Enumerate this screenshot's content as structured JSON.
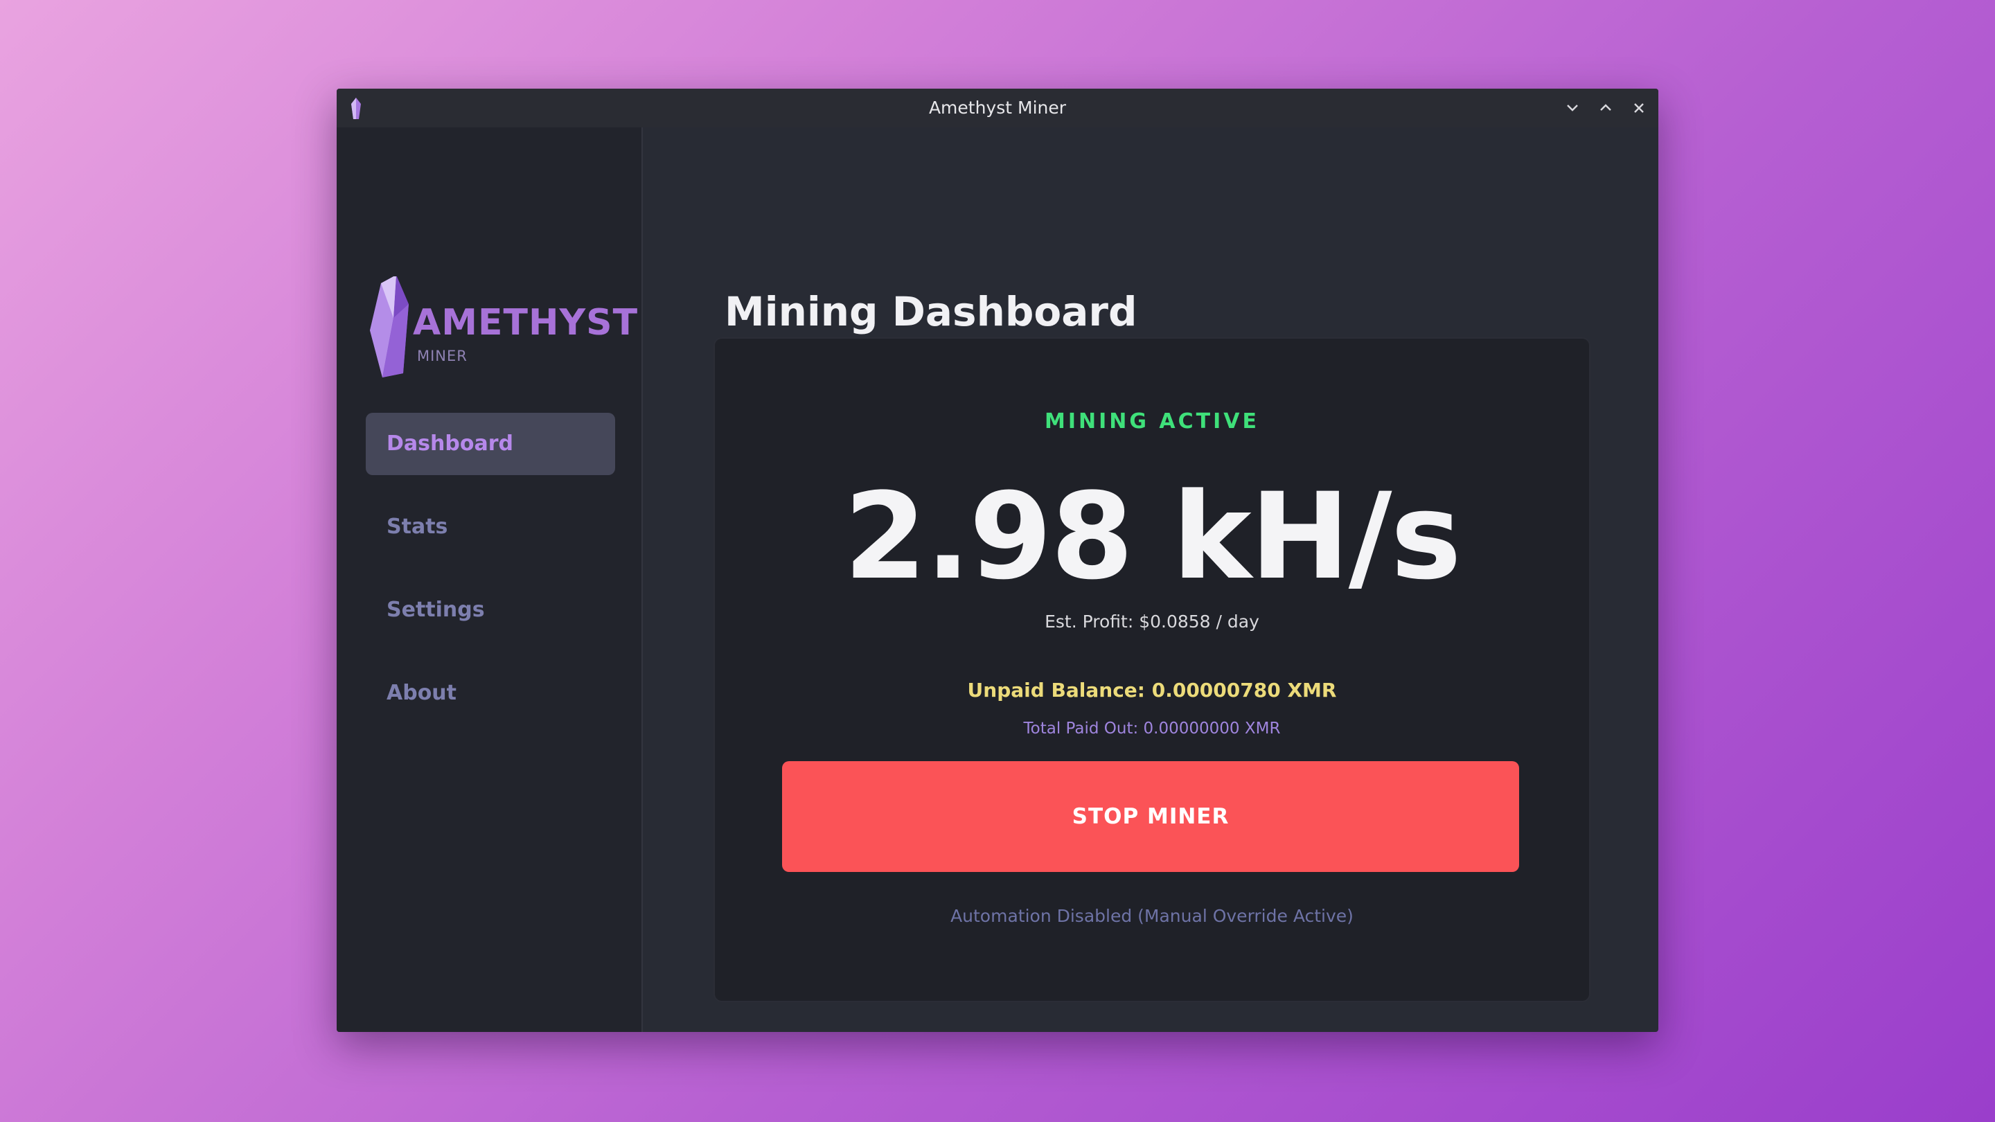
{
  "window": {
    "title": "Amethyst Miner"
  },
  "sidebar": {
    "logo": {
      "word": "AMETHYST",
      "sub": "MINER"
    },
    "items": [
      {
        "label": "Dashboard",
        "active": true
      },
      {
        "label": "Stats",
        "active": false
      },
      {
        "label": "Settings",
        "active": false
      },
      {
        "label": "About",
        "active": false
      }
    ]
  },
  "main": {
    "title": "Mining Dashboard",
    "card": {
      "status": "MINING ACTIVE",
      "hashrate": "2.98 kH/s",
      "profit": "Est. Profit: $0.0858 / day",
      "unpaid": "Unpaid Balance: 0.00000780 XMR",
      "total_paid": "Total Paid Out: 0.00000000 XMR",
      "stop_button": "STOP MINER",
      "automation": "Automation Disabled (Manual Override Active)"
    }
  },
  "icons": {
    "app": "amethyst-crystal-icon",
    "minimize": "chevron-down-icon",
    "maximize": "chevron-up-icon",
    "close": "close-icon"
  },
  "colors": {
    "accent": "#b688ea",
    "status_active": "#3fe07a",
    "stop_button": "#fb5357",
    "unpaid": "#ecdb7a"
  }
}
